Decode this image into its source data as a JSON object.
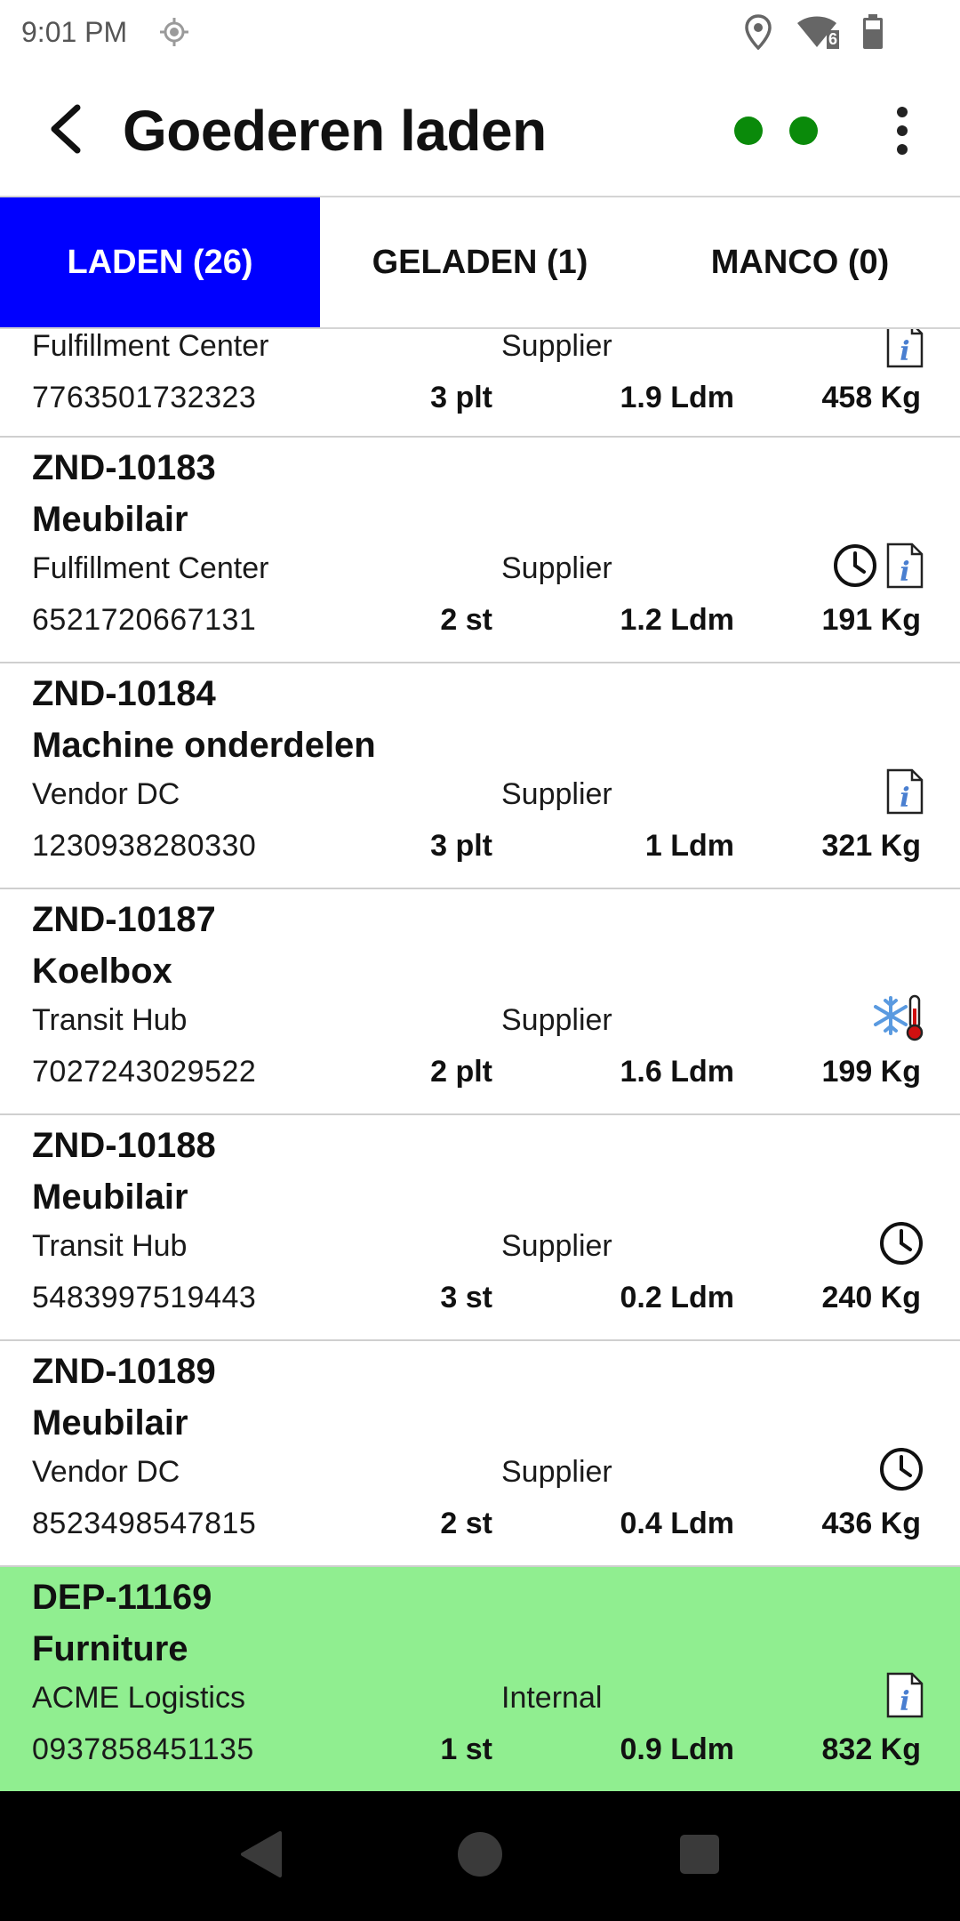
{
  "status_bar": {
    "time": "9:01 PM",
    "wifi_badge": "6"
  },
  "app_bar": {
    "title": "Goederen laden",
    "indicator_color": "#0a8a0a"
  },
  "tabs": [
    {
      "label": "LADEN (26)",
      "active": true
    },
    {
      "label": "GELADEN (1)",
      "active": false
    },
    {
      "label": "MANCO (0)",
      "active": false
    }
  ],
  "accent_color": "#0000ff",
  "highlight_color": "#90ee90",
  "items": [
    {
      "code": "",
      "description": "",
      "location": "Fulfillment Center",
      "role": "Supplier",
      "barcode": "7763501732323",
      "qty": "3 plt",
      "ldm": "1.9 Ldm",
      "kg": "458 Kg",
      "icons": [
        "info-document-icon"
      ]
    },
    {
      "code": "ZND-10183",
      "description": "Meubilair",
      "location": "Fulfillment Center",
      "role": "Supplier",
      "barcode": "6521720667131",
      "qty": "2 st",
      "ldm": "1.2 Ldm",
      "kg": "191 Kg",
      "icons": [
        "clock-icon",
        "info-document-icon"
      ]
    },
    {
      "code": "ZND-10184",
      "description": "Machine onderdelen",
      "location": "Vendor DC",
      "role": "Supplier",
      "barcode": "1230938280330",
      "qty": "3 plt",
      "ldm": "1 Ldm",
      "kg": "321 Kg",
      "icons": [
        "info-document-icon"
      ]
    },
    {
      "code": "ZND-10187",
      "description": "Koelbox",
      "location": "Transit Hub",
      "role": "Supplier",
      "barcode": "7027243029522",
      "qty": "2 plt",
      "ldm": "1.6 Ldm",
      "kg": "199 Kg",
      "icons": [
        "frozen-thermometer-icon"
      ]
    },
    {
      "code": "ZND-10188",
      "description": "Meubilair",
      "location": "Transit Hub",
      "role": "Supplier",
      "barcode": "5483997519443",
      "qty": "3 st",
      "ldm": "0.2 Ldm",
      "kg": "240 Kg",
      "icons": [
        "clock-icon"
      ]
    },
    {
      "code": "ZND-10189",
      "description": "Meubilair",
      "location": "Vendor DC",
      "role": "Supplier",
      "barcode": "8523498547815",
      "qty": "2 st",
      "ldm": "0.4 Ldm",
      "kg": "436 Kg",
      "icons": [
        "clock-icon"
      ]
    },
    {
      "code": "DEP-11169",
      "description": "Furniture",
      "location": "ACME Logistics",
      "role": "Internal",
      "barcode": "0937858451135",
      "qty": "1 st",
      "ldm": "0.9 Ldm",
      "kg": "832 Kg",
      "icons": [
        "info-document-icon"
      ],
      "highlighted": true
    }
  ],
  "nav_bar": {
    "icons": [
      "back-triangle-icon",
      "home-circle-icon",
      "recents-square-icon"
    ]
  }
}
